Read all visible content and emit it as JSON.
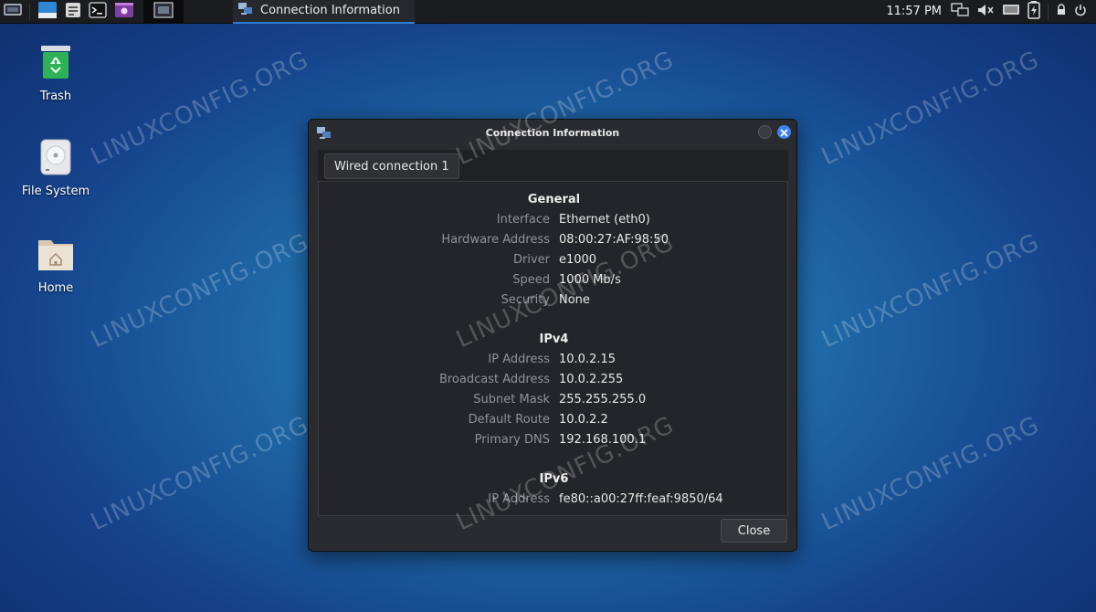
{
  "panel": {
    "task_title": "Connection Information",
    "clock": "11:57 PM"
  },
  "desktop": {
    "icons": [
      {
        "label": "Trash"
      },
      {
        "label": "File System"
      },
      {
        "label": "Home"
      }
    ]
  },
  "watermark": "LINUXCONFIG.ORG",
  "dialog": {
    "title": "Connection Information",
    "tab_label": "Wired connection 1",
    "sections": {
      "general": {
        "title": "General",
        "rows": [
          {
            "key": "Interface",
            "value": "Ethernet (eth0)"
          },
          {
            "key": "Hardware Address",
            "value": "08:00:27:AF:98:50"
          },
          {
            "key": "Driver",
            "value": "e1000"
          },
          {
            "key": "Speed",
            "value": "1000 Mb/s"
          },
          {
            "key": "Security",
            "value": "None"
          }
        ]
      },
      "ipv4": {
        "title": "IPv4",
        "rows": [
          {
            "key": "IP Address",
            "value": "10.0.2.15"
          },
          {
            "key": "Broadcast Address",
            "value": "10.0.2.255"
          },
          {
            "key": "Subnet Mask",
            "value": "255.255.255.0"
          },
          {
            "key": "Default Route",
            "value": "10.0.2.2"
          },
          {
            "key": "Primary DNS",
            "value": "192.168.100.1"
          }
        ]
      },
      "ipv6": {
        "title": "IPv6",
        "rows": [
          {
            "key": "IP Address",
            "value": "fe80::a00:27ff:feaf:9850/64"
          }
        ]
      }
    },
    "close_label": "Close"
  },
  "colors": {
    "accent": "#2f7dd1",
    "close_circle": "#3b82f6"
  }
}
